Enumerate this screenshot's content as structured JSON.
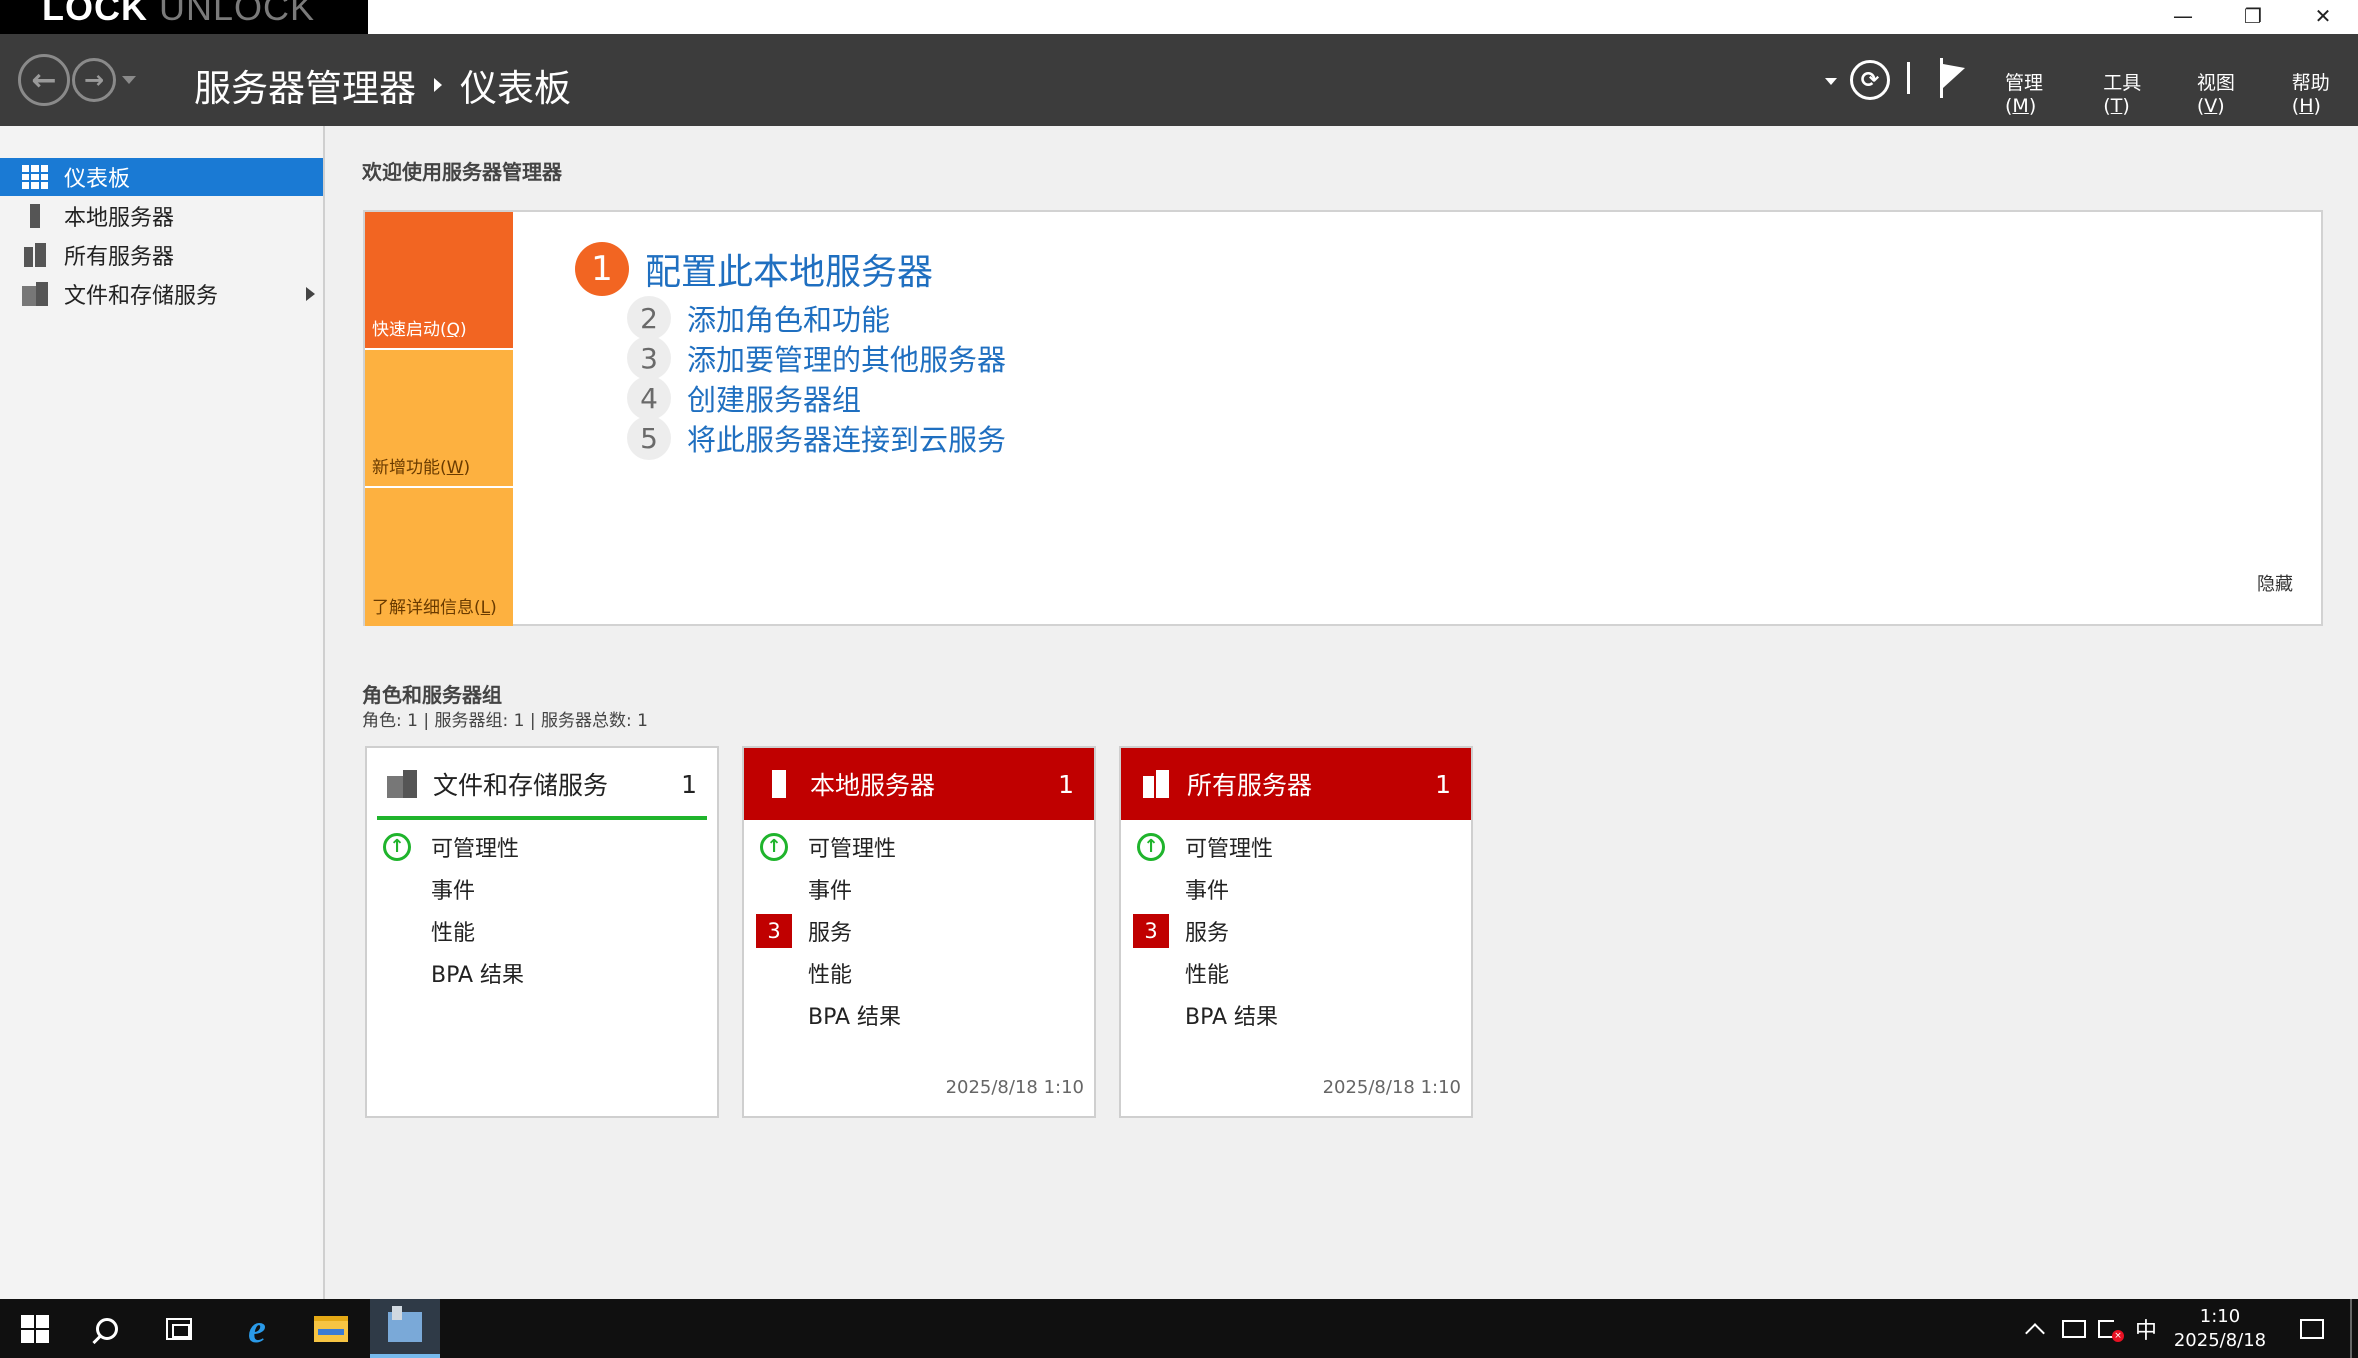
{
  "overlay": {
    "lock": "LOCK",
    "unlock": "UNLOCK"
  },
  "window": {
    "minimize": "—",
    "maximize": "❐",
    "close": "✕"
  },
  "header": {
    "breadcrumb_root": "服务器管理器",
    "breadcrumb_current": "仪表板",
    "menu": [
      {
        "label": "管理(",
        "key": "M",
        "suffix": ")"
      },
      {
        "label": "工具(",
        "key": "T",
        "suffix": ")"
      },
      {
        "label": "视图(",
        "key": "V",
        "suffix": ")"
      },
      {
        "label": "帮助(",
        "key": "H",
        "suffix": ")"
      }
    ]
  },
  "sidebar": {
    "items": [
      {
        "label": "仪表板",
        "icon": "dashboard-icon",
        "active": true
      },
      {
        "label": "本地服务器",
        "icon": "server-icon"
      },
      {
        "label": "所有服务器",
        "icon": "servers-icon"
      },
      {
        "label": "文件和存储服务",
        "icon": "file-storage-icon",
        "expandable": true
      }
    ]
  },
  "welcome": {
    "title": "欢迎使用服务器管理器",
    "tiles": [
      {
        "label": "快速启动(",
        "key": "Q",
        "suffix": ")"
      },
      {
        "label": "新增功能(",
        "key": "W",
        "suffix": ")"
      },
      {
        "label": "了解详细信息(",
        "key": "L",
        "suffix": ")"
      }
    ],
    "main_step": {
      "number": "1",
      "label": "配置此本地服务器"
    },
    "steps": [
      {
        "number": "2",
        "label": "添加角色和功能"
      },
      {
        "number": "3",
        "label": "添加要管理的其他服务器"
      },
      {
        "number": "4",
        "label": "创建服务器组"
      },
      {
        "number": "5",
        "label": "将此服务器连接到云服务"
      }
    ],
    "hide": "隐藏"
  },
  "roles": {
    "title": "角色和服务器组",
    "summary": "角色: 1 | 服务器组: 1 | 服务器总数: 1",
    "cards": [
      {
        "title": "文件和存储服务",
        "count": "1",
        "status": "ok",
        "rows": [
          {
            "label": "可管理性",
            "mark": "up"
          },
          {
            "label": "事件"
          },
          {
            "label": "性能"
          },
          {
            "label": "BPA 结果"
          }
        ],
        "timestamp": ""
      },
      {
        "title": "本地服务器",
        "count": "1",
        "status": "alert",
        "rows": [
          {
            "label": "可管理性",
            "mark": "up"
          },
          {
            "label": "事件"
          },
          {
            "label": "服务",
            "badge": "3"
          },
          {
            "label": "性能"
          },
          {
            "label": "BPA 结果"
          }
        ],
        "timestamp": "2025/8/18 1:10"
      },
      {
        "title": "所有服务器",
        "count": "1",
        "status": "alert",
        "rows": [
          {
            "label": "可管理性",
            "mark": "up"
          },
          {
            "label": "事件"
          },
          {
            "label": "服务",
            "badge": "3"
          },
          {
            "label": "性能"
          },
          {
            "label": "BPA 结果"
          }
        ],
        "timestamp": "2025/8/18 1:10"
      }
    ]
  },
  "taskbar": {
    "ime": "中",
    "time": "1:10",
    "date": "2025/8/18"
  },
  "colors": {
    "accent": "#1a7ad4",
    "alert": "#c00000",
    "ok": "#1fb42c",
    "tile_primary": "#f26522",
    "tile_secondary": "#fdb140",
    "link": "#1f6fc0"
  }
}
